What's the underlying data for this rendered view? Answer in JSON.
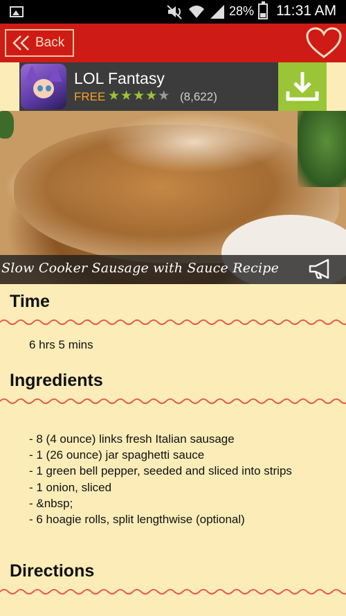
{
  "status_bar": {
    "battery_percent": "28%",
    "time": "11:31 AM",
    "icons": [
      "gallery-icon",
      "mute-icon",
      "wifi-icon",
      "signal-icon",
      "battery-icon"
    ]
  },
  "top_bar": {
    "back_label": "Back",
    "favorite_icon": "heart-icon",
    "color": "#cf1b16"
  },
  "ad": {
    "title": "LOL Fantasy",
    "price": "FREE",
    "rating_stars": 4,
    "rating_max": 5,
    "rating_count": "(8,622)",
    "install_icon": "download-icon",
    "accent": "#9ac536"
  },
  "recipe": {
    "title": "Slow Cooker Sausage with Sauce Recipe",
    "caption_icon": "megaphone-icon",
    "time_heading": "Time",
    "time_value": "6 hrs 5 mins",
    "ingredients_heading": "Ingredients",
    "ingredients": [
      " -  8 (4 ounce) links fresh Italian sausage",
      " -  1 (26 ounce) jar spaghetti sauce",
      " -  1 green bell pepper, seeded and sliced into strips",
      " -  1 onion, sliced",
      " -  &nbsp;",
      " -  6 hoagie rolls, split lengthwise (optional)"
    ],
    "directions_heading": "Directions"
  },
  "colors": {
    "background": "#fbecb8",
    "wave": "#e25b47"
  }
}
